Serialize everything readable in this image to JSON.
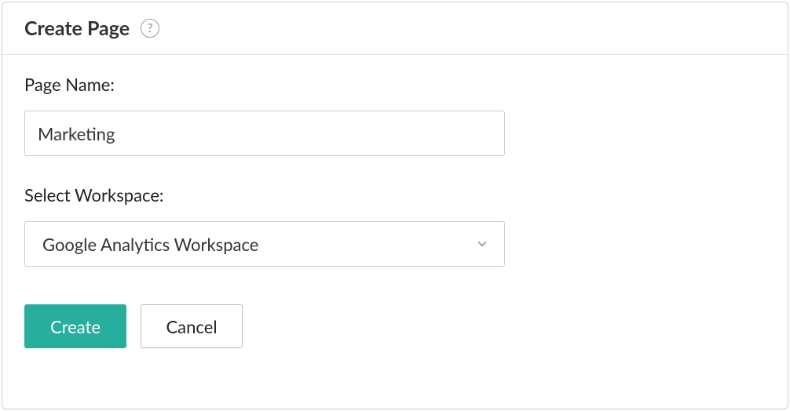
{
  "dialog": {
    "title": "Create Page",
    "help_icon_label": "?"
  },
  "form": {
    "page_name": {
      "label": "Page Name:",
      "value": "Marketing"
    },
    "workspace": {
      "label": "Select Workspace:",
      "selected": "Google Analytics Workspace"
    }
  },
  "buttons": {
    "create": "Create",
    "cancel": "Cancel"
  }
}
